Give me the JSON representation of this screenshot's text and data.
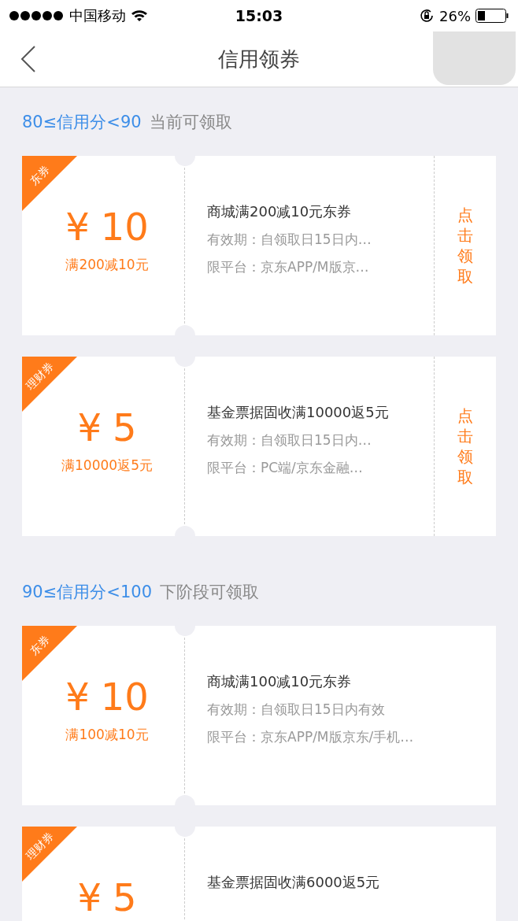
{
  "status_bar": {
    "carrier": "中国移动",
    "time": "15:03",
    "battery_percent": "26%"
  },
  "nav": {
    "title": "信用领券"
  },
  "sections": [
    {
      "range": "80≤信用分<90",
      "note": "当前可领取",
      "coupons": [
        {
          "tag": "东券",
          "currency": "¥",
          "amount": "10",
          "condition": "满200减10元",
          "title": "商城满200减10元东券",
          "validity": "有效期：自领取日15日内…",
          "platform": "限平台：京东APP/M版京…",
          "claim": "点击领取"
        },
        {
          "tag": "理财券",
          "currency": "¥",
          "amount": "5",
          "condition": "满10000返5元",
          "title": "基金票据固收满10000返5元",
          "validity": "有效期：自领取日15日内…",
          "platform": "限平台：PC端/京东金融…",
          "claim": "点击领取"
        }
      ]
    },
    {
      "range": "90≤信用分<100",
      "note": "下阶段可领取",
      "coupons": [
        {
          "tag": "东券",
          "currency": "¥",
          "amount": "10",
          "condition": "满100减10元",
          "title": "商城满100减10元东券",
          "validity": "有效期：自领取日15日内有效",
          "platform": "限平台：京东APP/M版京东/手机…"
        },
        {
          "tag": "理财券",
          "currency": "¥",
          "amount": "5",
          "title": "基金票据固收满6000返5元"
        }
      ]
    }
  ]
}
